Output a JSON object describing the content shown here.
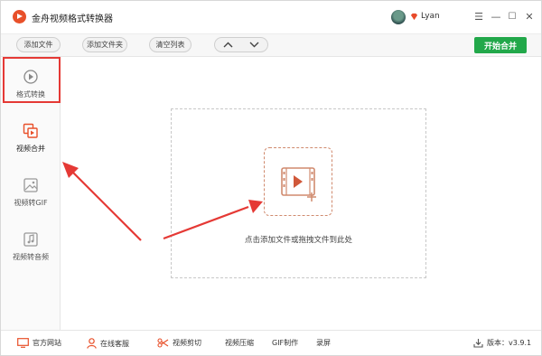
{
  "app": {
    "title": "金舟视频格式转换器"
  },
  "user": {
    "name": "Lyan"
  },
  "window_controls": {
    "menu": "☰",
    "minimize": "—",
    "maximize": "☐",
    "close": "✕"
  },
  "toolbar": {
    "add_file": "添加文件",
    "add_folder": "添加文件夹",
    "clear_list": "清空列表",
    "up": "︿",
    "down": "﹀",
    "start_merge": "开始合并"
  },
  "sidebar": {
    "items": [
      {
        "label": "格式转换",
        "icon": "format-convert-icon"
      },
      {
        "label": "视频合并",
        "icon": "video-merge-icon",
        "active": true
      },
      {
        "label": "视频转GIF",
        "icon": "video-to-gif-icon"
      },
      {
        "label": "视频转音频",
        "icon": "video-to-audio-icon"
      }
    ]
  },
  "main": {
    "drop_hint": "点击添加文件或拖拽文件到此处"
  },
  "footer": {
    "website": "官方网站",
    "support": "在线客服",
    "video_cut": "视频剪切",
    "video_compress": "视频压缩",
    "gif_make": "GIF制作",
    "record": "录屏",
    "version_label": "版本：v3.9.1"
  },
  "colors": {
    "accent": "#22a84a",
    "highlight": "#e53935",
    "brand": "#e8502a"
  }
}
